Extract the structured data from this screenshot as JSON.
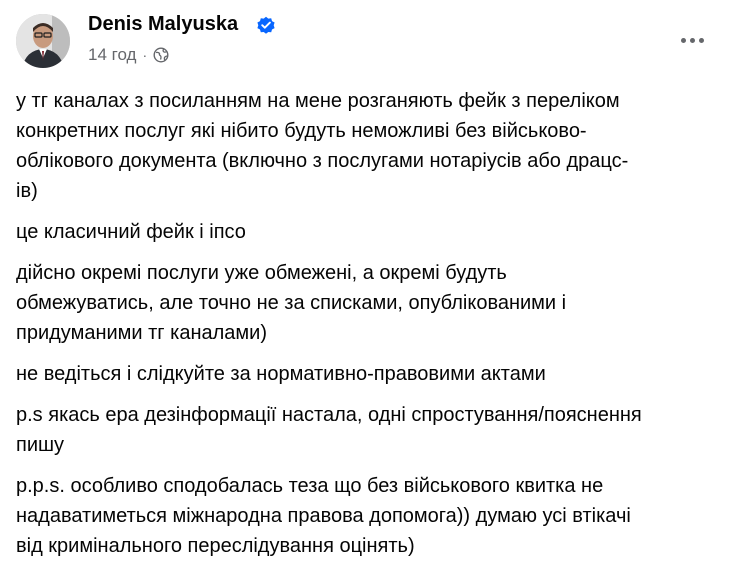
{
  "author": {
    "name": "Denis Malyuska",
    "verified_icon": "verified-badge-icon",
    "avatar_icon": "avatar-photo"
  },
  "meta": {
    "time": "14 год",
    "separator": "·",
    "audience_icon": "globe-icon"
  },
  "menu": {
    "more_icon": "more-horizontal-icon"
  },
  "body": {
    "paragraphs": [
      "у тг каналах з посиланням на мене розганяють фейк з переліком\nконкретних послуг які нібито будуть неможливі без військово-\nоблікового документа (включно з послугами нотаріусів або драцс-\nів)",
      "це класичний фейк і іпсо",
      "дійсно окремі послуги уже обмежені, а окремі будуть\nобмежуватись, але точно не за списками, опублікованими і\nпридуманими тг каналами)",
      "не ведіться і слідкуйте за нормативно-правовими актами",
      "p.s якась ера дезінформації настала, одні спростування/пояснення\nпишу",
      "p.p.s. особливо сподобалась теза що без військового квитка не\nнадаватиметься міжнародна правова допомога)) думаю усі втікачі\nвід кримінального переслідування оцінять)"
    ]
  },
  "colors": {
    "text": "#050505",
    "secondary": "#65676b",
    "verified": "#0866ff"
  }
}
